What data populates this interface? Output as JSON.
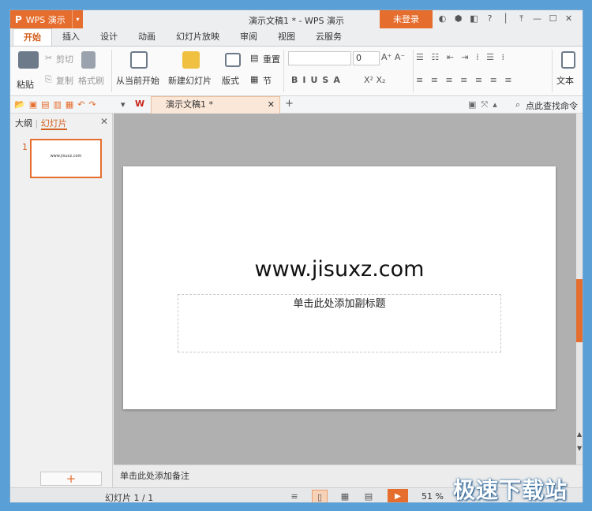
{
  "app": {
    "badge": "WPS 演示",
    "logo": "P",
    "title": "演示文稿1 * - WPS 演示",
    "login": "未登录"
  },
  "menu_tabs": [
    "开始",
    "插入",
    "设计",
    "动画",
    "幻灯片放映",
    "审阅",
    "视图",
    "云服务"
  ],
  "ribbon": {
    "paste": "粘贴",
    "cut": "剪切",
    "copy": "复制",
    "format_painter": "格式刷",
    "from_current": "从当前开始",
    "new_slide": "新建幻灯片",
    "layout": "版式",
    "reset": "重置",
    "section": "节",
    "font_size": "0",
    "text_box": "文本"
  },
  "quickbar": {
    "doc_tab": "演示文稿1 *",
    "find": "点此查找命令"
  },
  "sidebar": {
    "tab_outline": "大纲",
    "tab_slides": "幻灯片",
    "slide_number": "1",
    "thumb_text": "www.jisuxz.com",
    "add": "+"
  },
  "slide": {
    "title": "www.jisuxz.com",
    "subtitle_placeholder": "单击此处添加副标题"
  },
  "notes_placeholder": "单击此处添加备注",
  "status": {
    "slide_info": "幻灯片 1 / 1",
    "zoom": "51 %"
  },
  "watermark": "极速下载站",
  "colors": {
    "accent": "#e56e2f",
    "canvas": "#b0b0b0"
  }
}
